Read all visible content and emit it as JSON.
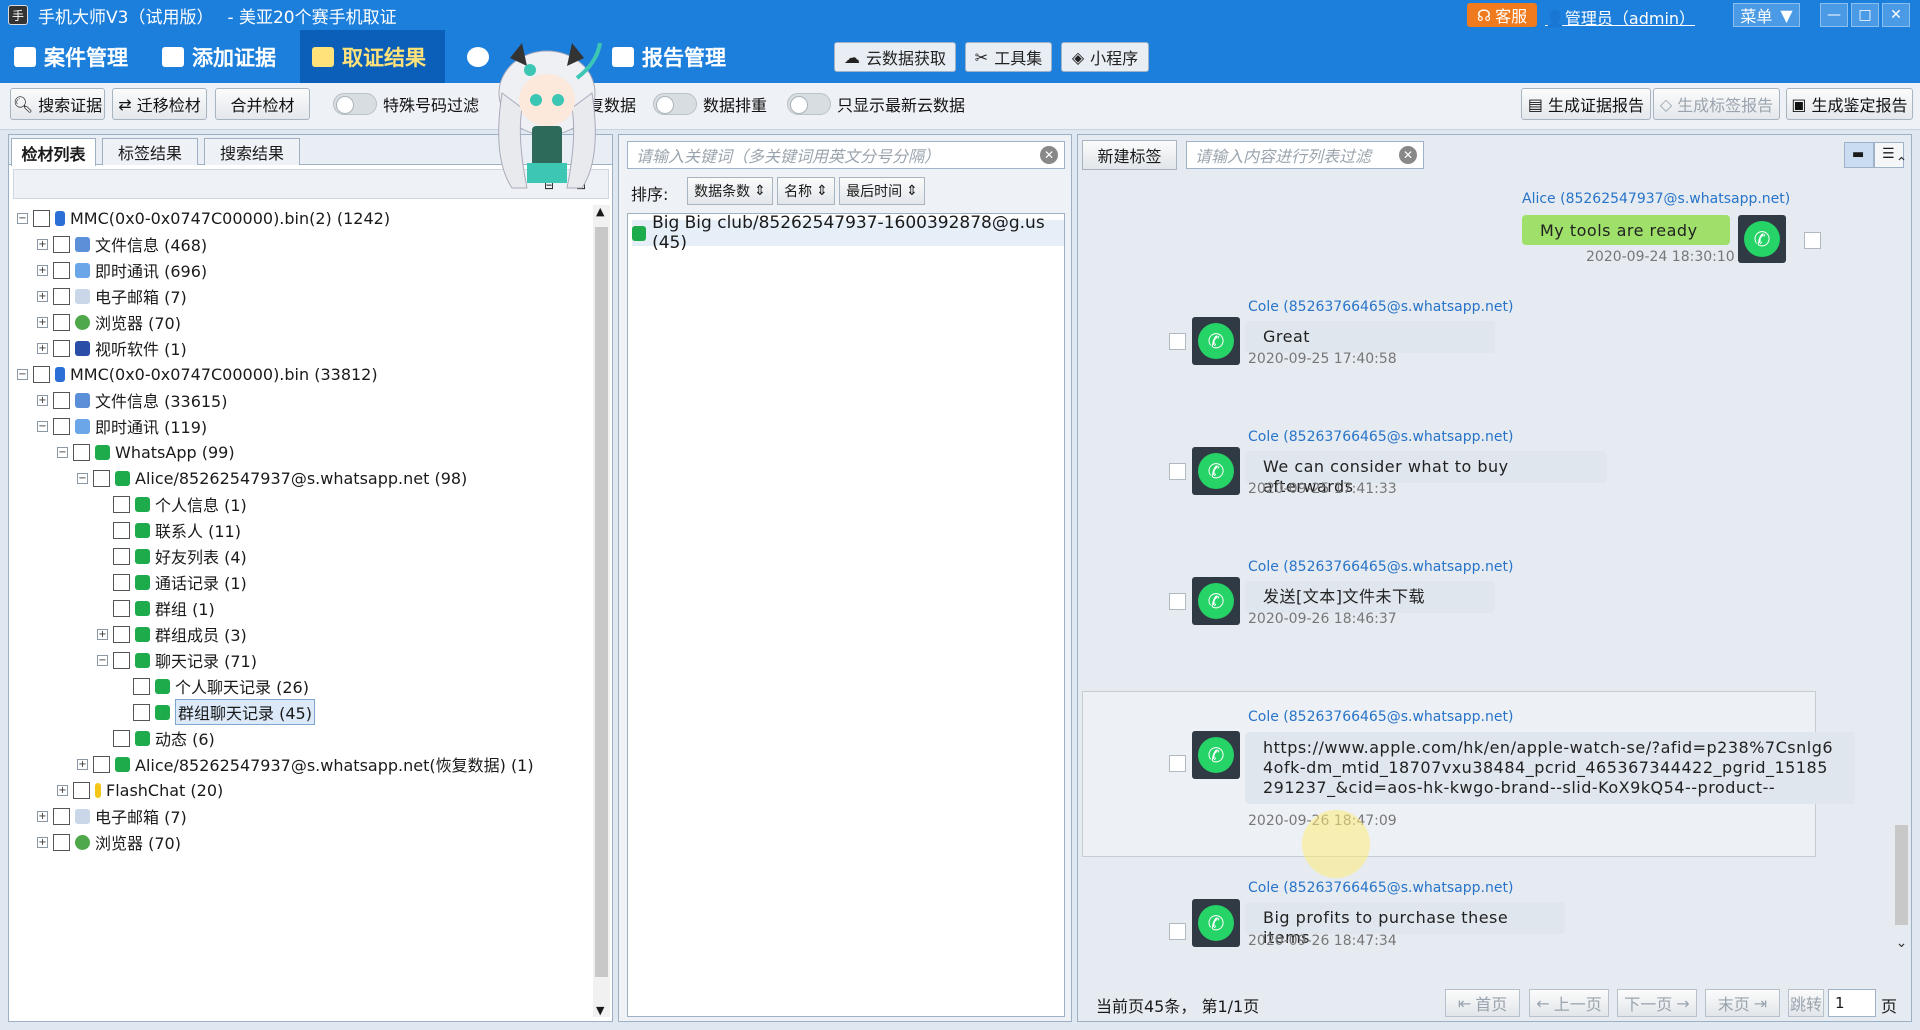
{
  "titlebar": {
    "app_title": "手机大师V3（试用版）",
    "case_title": "- 美亚20个赛手机取证",
    "service_label": "客服",
    "admin_label": "管理员（admin）",
    "menu_label": "菜单"
  },
  "nav": {
    "items": [
      "案件管理",
      "添加证据",
      "取证结果",
      "",
      "报告管理"
    ],
    "cloud_label": "云数据获取",
    "tools_label": "工具集",
    "miniapp_label": "小程序"
  },
  "toolbar": {
    "search_evidence": "搜索证据",
    "migrate": "迁移检材",
    "merge": "合并检材",
    "toggle_special": "特殊号码过滤",
    "toggle_recover": "恢复数据",
    "toggle_dedupe": "数据排重",
    "toggle_cloud": "只显示最新云数据",
    "gen_evidence_report": "生成证据报告",
    "gen_tag_report": "生成标签报告",
    "gen_appraisal_report": "生成鉴定报告"
  },
  "left": {
    "tabs": [
      "检材列表",
      "标签结果",
      "搜索结果"
    ],
    "tree": [
      {
        "label": "MMC(0x0-0x0747C00000).bin(2) (1242)"
      },
      {
        "label": "文件信息 (468)"
      },
      {
        "label": "即时通讯 (696)"
      },
      {
        "label": "电子邮箱 (7)"
      },
      {
        "label": "浏览器 (70)"
      },
      {
        "label": "视听软件 (1)"
      },
      {
        "label": "MMC(0x0-0x0747C00000).bin (33812)"
      },
      {
        "label": "文件信息 (33615)"
      },
      {
        "label": "即时通讯 (119)"
      },
      {
        "label": "WhatsApp (99)"
      },
      {
        "label": "Alice/85262547937@s.whatsapp.net (98)"
      },
      {
        "label": "个人信息 (1)"
      },
      {
        "label": "联系人 (11)"
      },
      {
        "label": "好友列表 (4)"
      },
      {
        "label": "通话记录 (1)"
      },
      {
        "label": "群组 (1)"
      },
      {
        "label": "群组成员 (3)"
      },
      {
        "label": "聊天记录 (71)"
      },
      {
        "label": "个人聊天记录 (26)"
      },
      {
        "label": "群组聊天记录 (45)"
      },
      {
        "label": "动态 (6)"
      },
      {
        "label": "Alice/85262547937@s.whatsapp.net(恢复数据) (1)"
      },
      {
        "label": "FlashChat (20)"
      },
      {
        "label": "电子邮箱 (7)"
      },
      {
        "label": "浏览器 (70)"
      }
    ]
  },
  "middle": {
    "search_placeholder": "请输入关键词（多关键词用英文分号分隔）",
    "sort_label": "排序:",
    "sort_buttons": [
      "数据条数",
      "名称",
      "最后时间"
    ],
    "items": [
      "Big Big club/85262547937-1600392878@g.us (45)"
    ]
  },
  "right": {
    "new_tag": "新建标签",
    "filter_placeholder": "请输入内容进行列表过滤",
    "messages": [
      {
        "sender": "Alice (85262547937@s.whatsapp.net)",
        "text": "My tools are ready",
        "time": "2020-09-24 18:30:10"
      },
      {
        "sender": "Cole (85263766465@s.whatsapp.net)",
        "text": "Great",
        "time": "2020-09-25 17:40:58"
      },
      {
        "sender": "Cole (85263766465@s.whatsapp.net)",
        "text": "We can consider what to buy afterwards",
        "time": "2020-09-25 17:41:33"
      },
      {
        "sender": "Cole (85263766465@s.whatsapp.net)",
        "text": "发送[文本]文件未下载",
        "time": "2020-09-26 18:46:37"
      },
      {
        "sender": "Cole (85263766465@s.whatsapp.net)",
        "text": "https://www.apple.com/hk/en/apple-watch-se/?afid=p238%7Csnlg64ofk-dm_mtid_18707vxu38484_pcrid_465367344422_pgrid_15185291237_&cid=aos-hk-kwgo-brand--slid-KoX9kQ54--product--",
        "time": "2020-09-26 18:47:09"
      },
      {
        "sender": "Cole (85263766465@s.whatsapp.net)",
        "text": "Big profits to purchase these items",
        "time": "2020-09-26 18:47:34"
      }
    ],
    "footer": {
      "info": "当前页45条，    第1/1页",
      "first": "首页",
      "prev": "上一页",
      "next": "下一页",
      "last": "末页",
      "jump": "跳转",
      "page_value": "1",
      "page_unit": "页"
    }
  }
}
